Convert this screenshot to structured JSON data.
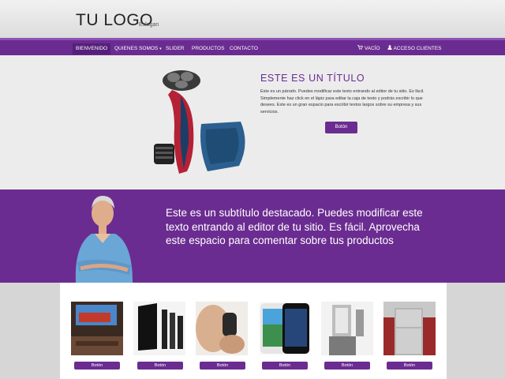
{
  "header": {
    "logo": "TU LOGO",
    "slogan": "Eslogan"
  },
  "nav": {
    "items": [
      "Bienvenido",
      "Quienes somos",
      "Slider",
      "Productos",
      "Contacto"
    ],
    "dropdown_caret": "▾",
    "cart": "VACÍO",
    "login": "ACCESO CLIENTES"
  },
  "hero": {
    "title": "ESTE ES UN TÍTULO",
    "text": "Este es un párrafo. Puedes modificar este texto entrando al editor de tu sitio. Es fácil. Simplemente haz click en el lápiz para editar la caja de texto y podrás escribir lo que desees. Este es un gran espacio para escribir textos largos sobre su empresa y sus servicios.",
    "button": "Botón"
  },
  "band": {
    "text": "Este es un subtítulo destacado. Puedes modificar este texto entrando al editor de tu sitio. Es fácil. Aprovecha este espacio para comentar sobre tus productos"
  },
  "products": {
    "button": "Botón",
    "items": [
      "tv",
      "speakers",
      "shaver",
      "phone",
      "blender",
      "fridge"
    ]
  },
  "colors": {
    "brand_purple": "#6b2c91",
    "nav_highlight": "#8d51b3",
    "hero_bg": "#ececec"
  },
  "icons": {
    "cart": "cart-icon",
    "user": "user-icon"
  }
}
